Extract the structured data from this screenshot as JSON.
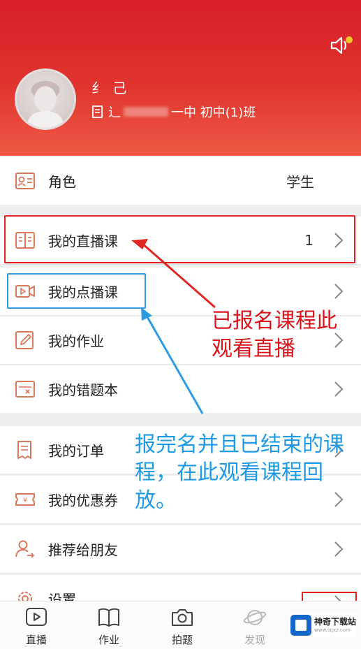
{
  "header": {
    "username": "纟 己",
    "school_prefix": "辶",
    "school_suffix": "一中 初中(1)班"
  },
  "menu": {
    "role": {
      "label": "角色",
      "value": "学生"
    },
    "live": {
      "label": "我的直播课",
      "value": "1"
    },
    "vod": {
      "label": "我的点播课"
    },
    "homework": {
      "label": "我的作业"
    },
    "mistakes": {
      "label": "我的错题本"
    },
    "orders": {
      "label": "我的订单"
    },
    "coupons": {
      "label": "我的优惠券"
    },
    "share": {
      "label": "推荐给朋友"
    },
    "settings": {
      "label": "设置"
    }
  },
  "annotations": {
    "red": "已报名课程此观看直播",
    "blue": "报完名并且已结束的课程，在此观看课程回放。"
  },
  "tabbar": {
    "live": "直播",
    "homework": "作业",
    "photo": "拍题",
    "discover": "发现"
  },
  "watermark": {
    "name": "神奇下载站",
    "sub": "www.sqxz.com"
  },
  "colors": {
    "header_red": "#d81e28",
    "annotation_red": "#d8141c",
    "annotation_blue": "#1f9be6",
    "icon_accent": "#d9785a"
  }
}
